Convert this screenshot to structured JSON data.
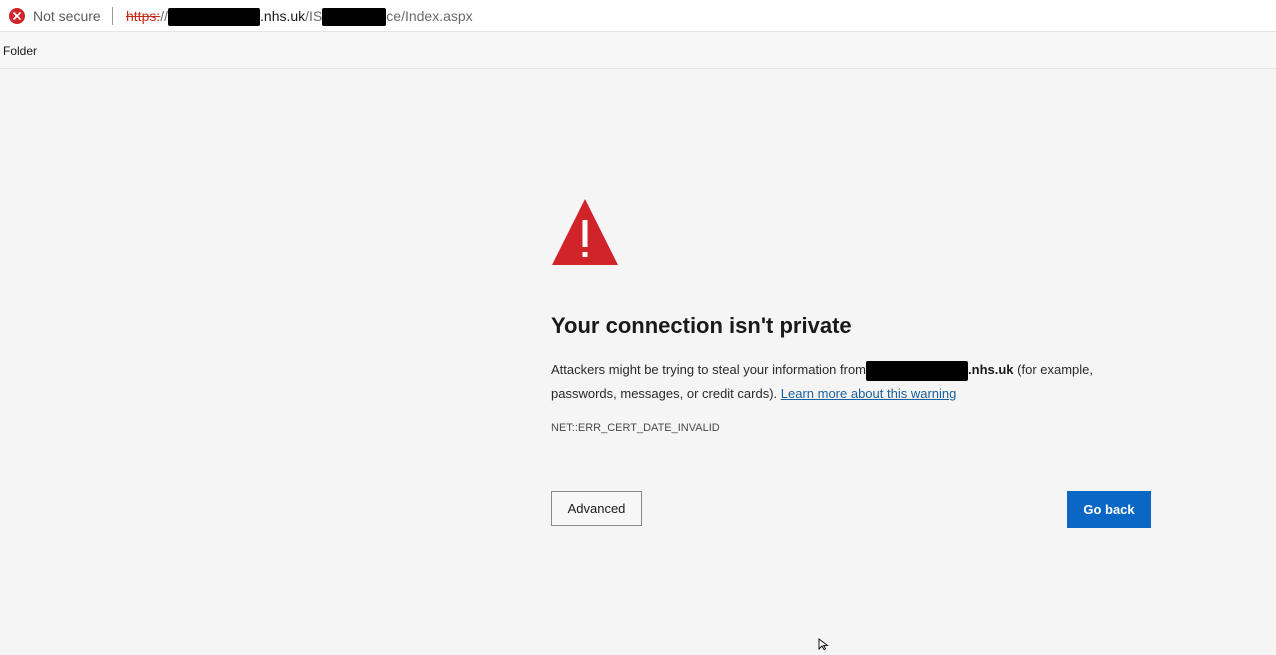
{
  "address_bar": {
    "security_label": "Not secure",
    "url_scheme": "https:",
    "url_sep": "//",
    "url_host_suffix": ".nhs.uk",
    "url_path_prefix": "/IS",
    "url_path_suffix": "ce/Index.aspx"
  },
  "favorites_bar": {
    "folder_label": "Folder"
  },
  "error_page": {
    "title": "Your connection isn't private",
    "body_prefix": "Attackers might be trying to steal your information from",
    "body_host": ".nhs.uk",
    "body_suffix": " (for example, passwords, messages, or credit cards). ",
    "learn_more_link": "Learn more about this warning",
    "error_code": "NET::ERR_CERT_DATE_INVALID",
    "advanced_button": "Advanced",
    "go_back_button": "Go back"
  },
  "colors": {
    "accent_blue": "#0a67c5",
    "warning_red": "#d0232a",
    "link": "#1a5fa0"
  },
  "icons": {
    "security": "error-circle-x-icon",
    "warning": "warning-triangle-icon",
    "cursor": "mouse-pointer-icon"
  }
}
